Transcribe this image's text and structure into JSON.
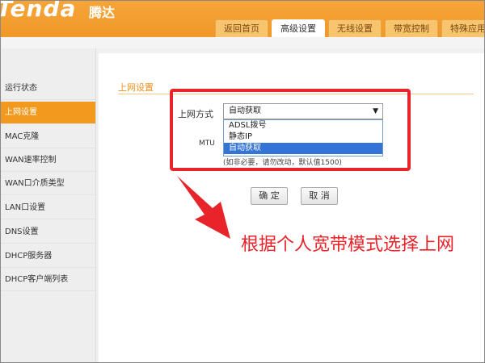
{
  "header": {
    "logo_text": "Tenda",
    "logo_cn": "腾达",
    "tabs": [
      {
        "label": "返回首页"
      },
      {
        "label": "高级设置"
      },
      {
        "label": "无线设置"
      },
      {
        "label": "带宽控制"
      },
      {
        "label": "特殊应用"
      }
    ],
    "active_tab": "高级设置"
  },
  "sidebar": {
    "items": [
      {
        "label": "运行状态"
      },
      {
        "label": "上网设置"
      },
      {
        "label": "MAC克隆"
      },
      {
        "label": "WAN速率控制"
      },
      {
        "label": "WAN口介质类型"
      },
      {
        "label": "LAN口设置"
      },
      {
        "label": "DNS设置"
      },
      {
        "label": "DHCP服务器"
      },
      {
        "label": "DHCP客户端列表"
      }
    ],
    "active": "上网设置"
  },
  "main": {
    "section_title": "上网设置",
    "mode_label": "上网方式",
    "select_value": "自动获取",
    "options": [
      "ADSL拨号",
      "静态IP",
      "自动获取"
    ],
    "selected_option": "自动获取",
    "mtu_label": "MTU",
    "hint": "(如非必要，请勿改动，默认值1500)",
    "ok_button": "确 定",
    "cancel_button": "取 消"
  },
  "overlay": {
    "annotation_text": "根据个人宽带模式选择上网",
    "color": "#e8232a"
  }
}
